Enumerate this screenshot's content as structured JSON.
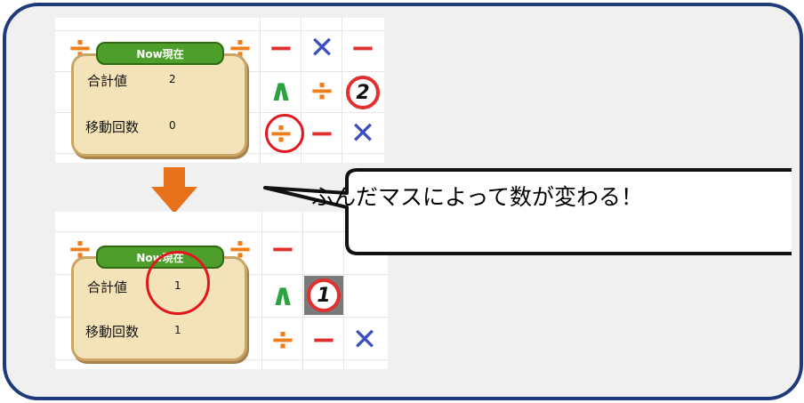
{
  "banner": {
    "label": "Now現在"
  },
  "panel": {
    "sum_label": "合計値",
    "moves_label": "移動回数"
  },
  "before": {
    "sum_value": "2",
    "moves_value": "0",
    "number_tile": "2"
  },
  "after": {
    "sum_value": "1",
    "moves_value": "1",
    "number_tile": "1"
  },
  "callout": {
    "text": "ふんだマスによって数が変わる！"
  },
  "symbols": {
    "minus": "−",
    "times": "✕",
    "divide": "÷",
    "caret": "∧"
  },
  "colors": {
    "frame_border": "#1f3a7a",
    "frame_bg": "#f0f0f0",
    "arrow": "#e8711c",
    "highlight_ring": "#e3161e",
    "banner_green": "#4d9e2a",
    "panel_parchment": "#f4e3b8"
  }
}
